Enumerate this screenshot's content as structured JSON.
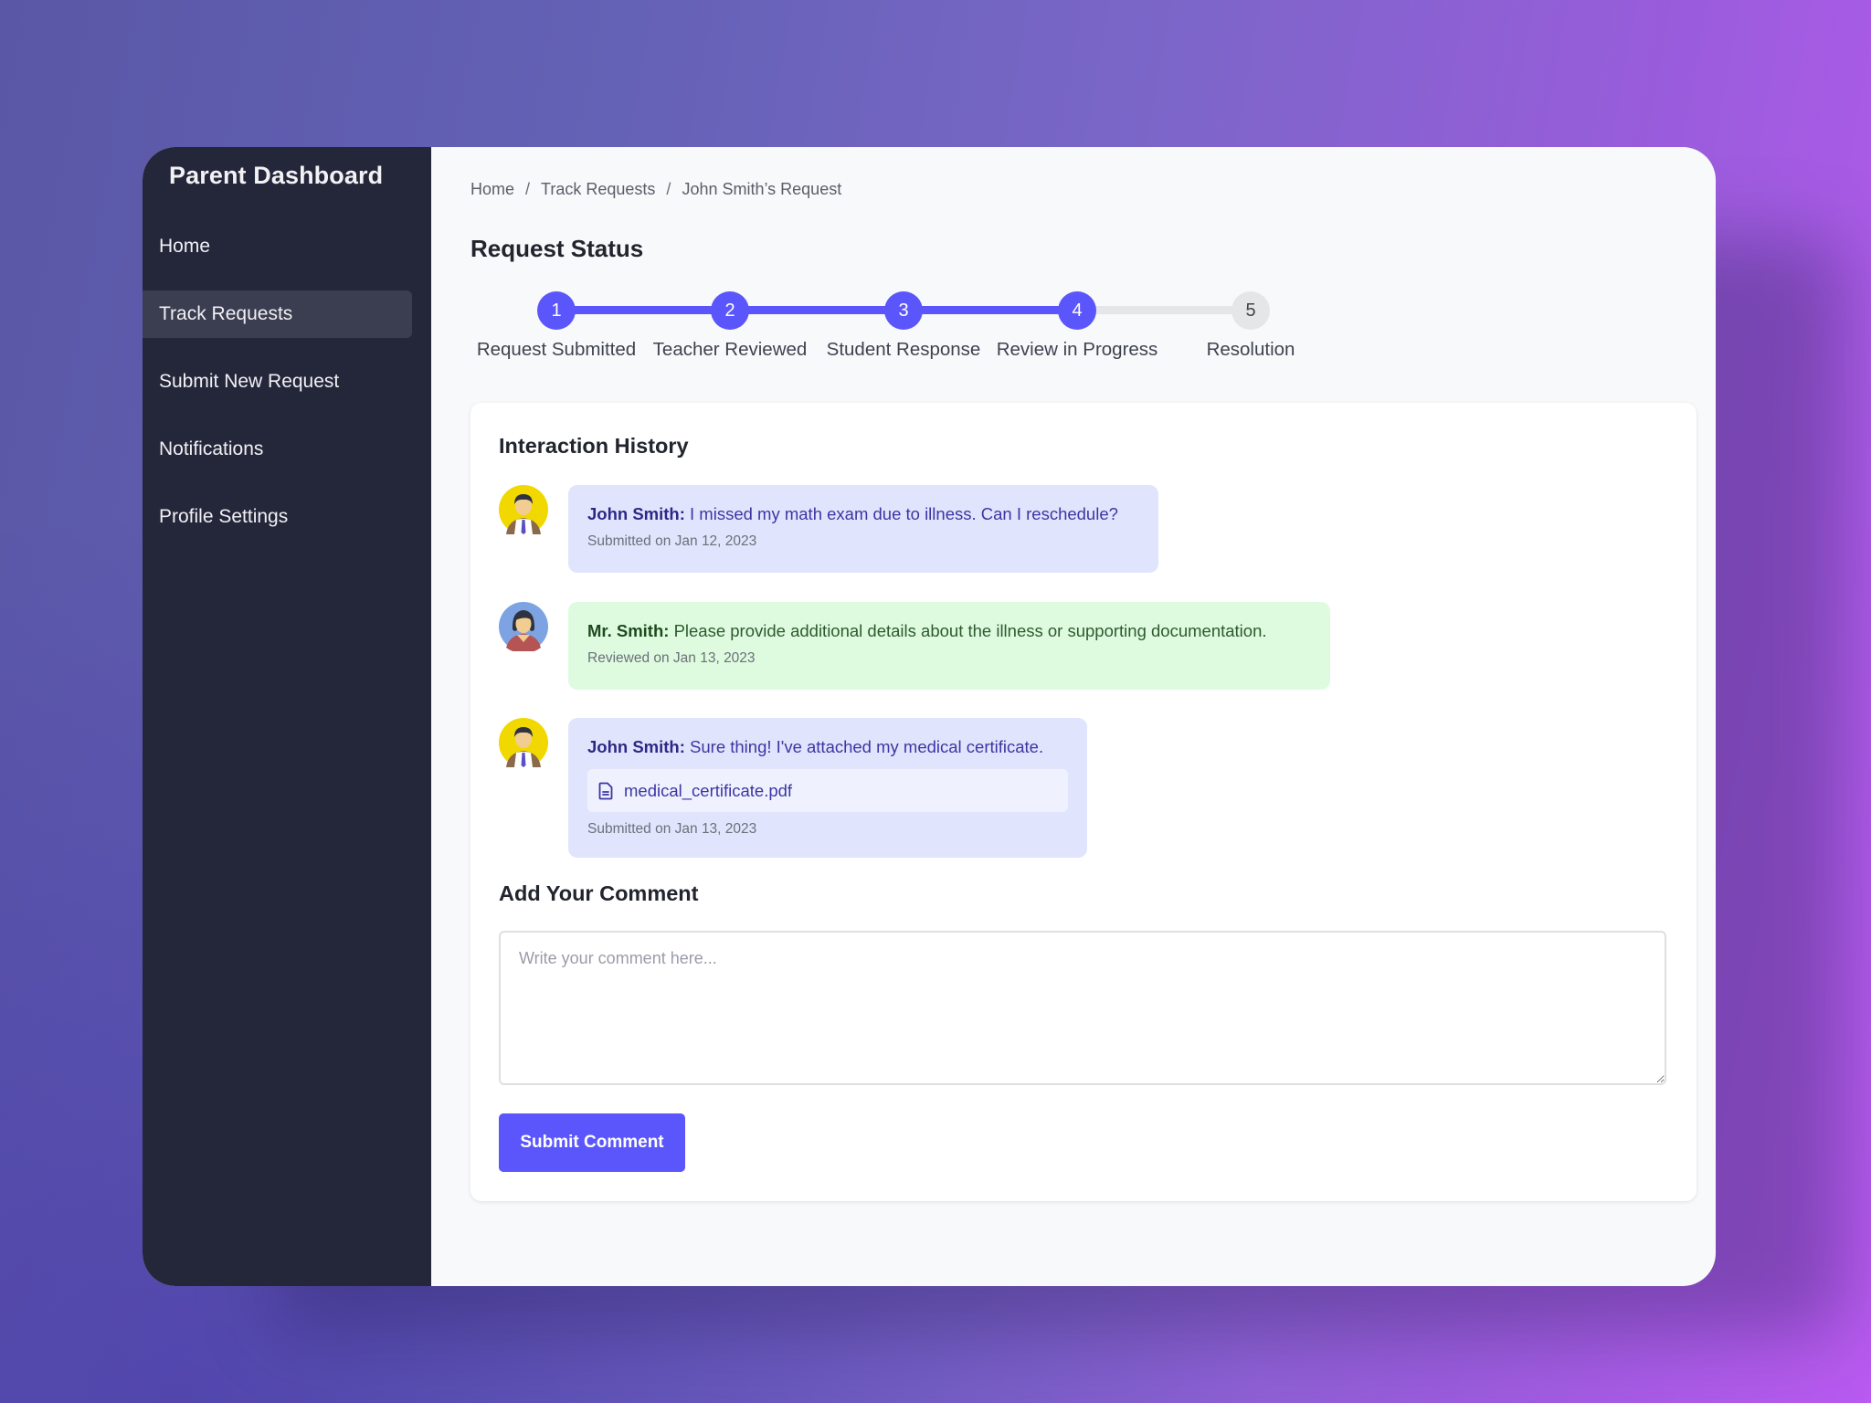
{
  "sidebar": {
    "title": "Parent Dashboard",
    "items": [
      {
        "label": "Home",
        "active": false
      },
      {
        "label": "Track Requests",
        "active": true
      },
      {
        "label": "Submit New Request",
        "active": false
      },
      {
        "label": "Notifications",
        "active": false
      },
      {
        "label": "Profile Settings",
        "active": false
      }
    ]
  },
  "breadcrumb": {
    "items": [
      "Home",
      "Track Requests",
      "John Smith’s Request"
    ],
    "separator": "/"
  },
  "status": {
    "title": "Request Status",
    "current_step": 4,
    "steps": [
      {
        "number": "1",
        "label": "Request Submitted",
        "complete": true
      },
      {
        "number": "2",
        "label": "Teacher Reviewed",
        "complete": true
      },
      {
        "number": "3",
        "label": "Student Response",
        "complete": true
      },
      {
        "number": "4",
        "label": "Review in Progress",
        "complete": true
      },
      {
        "number": "5",
        "label": "Resolution",
        "complete": false
      }
    ]
  },
  "history": {
    "title": "Interaction History",
    "messages": [
      {
        "author": "John Smith:",
        "text": "I missed my math exam due to illness. Can I reschedule?",
        "meta": "Submitted on Jan 12, 2023",
        "role": "student",
        "avatar": "student-avatar-icon"
      },
      {
        "author": "Mr. Smith:",
        "text": "Please provide additional details about the illness or supporting documentation.",
        "meta": "Reviewed on Jan 13, 2023",
        "role": "teacher",
        "avatar": "teacher-avatar-icon"
      },
      {
        "author": "John Smith:",
        "text": "Sure thing! I've attached my medical certificate.",
        "attachment": "medical_certificate.pdf",
        "attachment_icon": "document-icon",
        "meta": "Submitted on Jan 13, 2023",
        "role": "student",
        "avatar": "student-avatar-icon"
      }
    ]
  },
  "comment": {
    "title": "Add Your Comment",
    "placeholder": "Write your comment here...",
    "value": "",
    "submit_label": "Submit Comment"
  },
  "colors": {
    "accent": "#5b56fb",
    "sidebar_bg": "#24273a",
    "sidebar_active": "#3b3e51",
    "student_bubble": "#e0e5fd",
    "teacher_bubble": "#defbdf",
    "pending_step": "#e5e6e8"
  }
}
